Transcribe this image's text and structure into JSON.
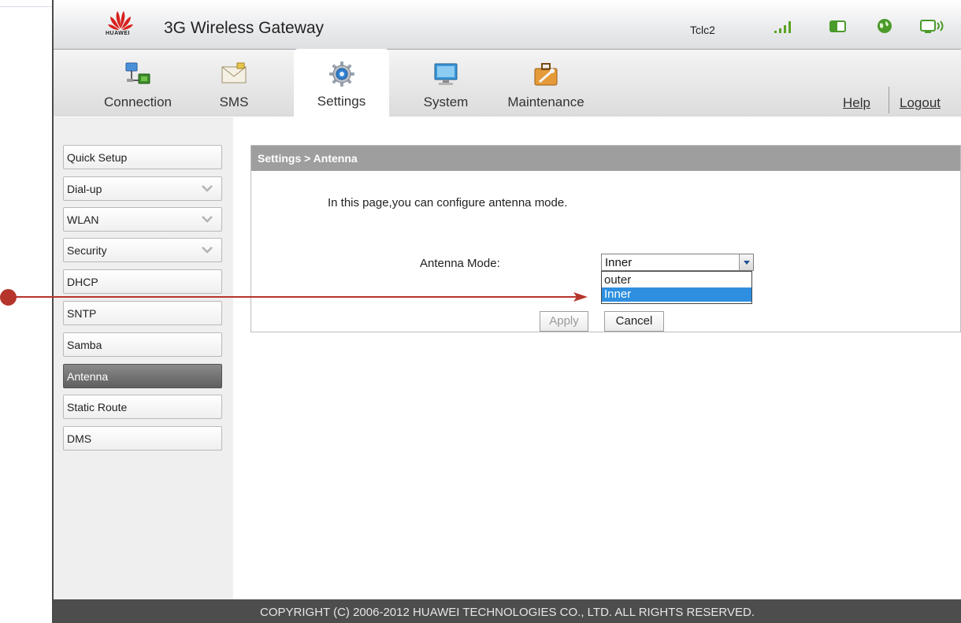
{
  "header": {
    "app_title": "3G Wireless Gateway",
    "operator": "Tclc2",
    "logo_text": "HUAWEI",
    "status_icons": [
      "signal-strength-icon",
      "sim-card-icon",
      "internet-globe-icon",
      "wifi-icon"
    ]
  },
  "nav": {
    "tabs": [
      {
        "label": "Connection",
        "icon": "connection-icon"
      },
      {
        "label": "SMS",
        "icon": "envelope-icon"
      },
      {
        "label": "Settings",
        "icon": "gear-icon"
      },
      {
        "label": "System",
        "icon": "monitor-icon"
      },
      {
        "label": "Maintenance",
        "icon": "toolbox-icon"
      }
    ],
    "active_tab": "Settings",
    "help": "Help",
    "logout": "Logout"
  },
  "sidebar": {
    "items": [
      {
        "label": "Quick Setup"
      },
      {
        "label": "Dial-up"
      },
      {
        "label": "WLAN"
      },
      {
        "label": "Security"
      },
      {
        "label": "DHCP"
      },
      {
        "label": "SNTP"
      },
      {
        "label": "Samba"
      },
      {
        "label": "Antenna"
      },
      {
        "label": "Static Route"
      },
      {
        "label": "DMS"
      }
    ],
    "active": "Antenna"
  },
  "main": {
    "breadcrumb": "Settings > Antenna",
    "description": "In this page,you can configure antenna mode.",
    "antenna_mode_label": "Antenna Mode:",
    "antenna_mode_value": "Inner",
    "antenna_mode_options": [
      "outer",
      "Inner"
    ],
    "apply_label": "Apply",
    "cancel_label": "Cancel"
  },
  "footer": {
    "copyright": "COPYRIGHT (C) 2006-2012 HUAWEI TECHNOLOGIES CO., LTD. ALL RIGHTS RESERVED."
  },
  "colors": {
    "accent_red": "#b5352c",
    "selection_blue": "#2e8fe0",
    "footer_bg": "#4d4d4d",
    "panel_header": "#9e9e9e"
  }
}
